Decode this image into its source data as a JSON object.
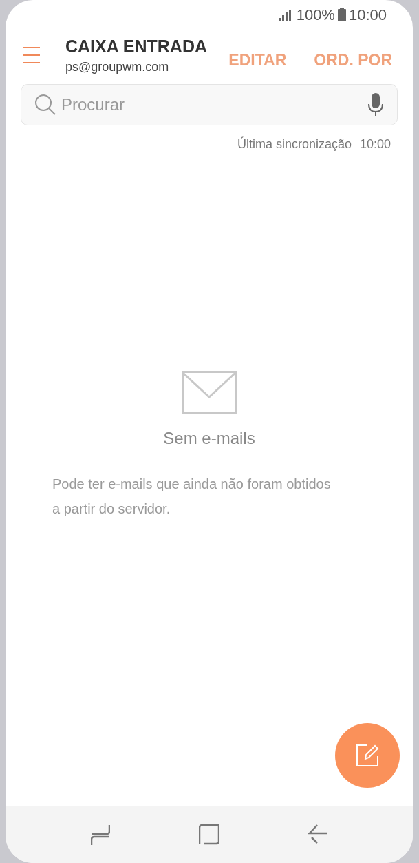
{
  "status_bar": {
    "battery": "100%",
    "time": "10:00"
  },
  "header": {
    "title": "CAIXA ENTRADA",
    "account": "ps@groupwm.com",
    "actions": [
      {
        "label": "EDITAR",
        "disabled": true
      },
      {
        "label": "ORD. POR",
        "disabled": true
      }
    ]
  },
  "search": {
    "placeholder": "Procurar"
  },
  "sync": {
    "label": "Última sincronização",
    "time": "10:00"
  },
  "empty_state": {
    "title": "Sem e-mails",
    "message": "Pode ter e-mails que ainda não foram obtidos a partir do servidor."
  }
}
